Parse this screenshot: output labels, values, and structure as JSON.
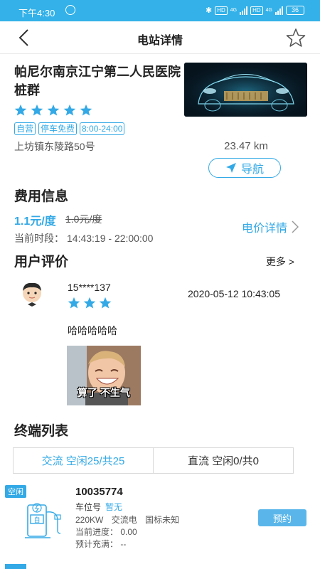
{
  "status_bar": {
    "time": "下午4:30",
    "net1": "HD",
    "net2": "4G",
    "net3": "HD",
    "net4": "4G",
    "battery": "36"
  },
  "nav": {
    "title": "电站详情",
    "back_icon": "back-arrow-icon",
    "fav_icon": "star-outline-icon"
  },
  "station": {
    "name": "帕尼尔南京江宁第二人民医院桩群",
    "rating": 5,
    "tags": [
      "自营",
      "停车免费",
      "8:00-24:00"
    ],
    "address": "上坊镇东陵路50号",
    "distance": "23.47 km",
    "nav_label": "导航"
  },
  "fee": {
    "title": "费用信息",
    "price": "1.1元/度",
    "original_price": "1.0元/度",
    "period_label": "当前时段：",
    "period": "14:43:19 - 22:00:00",
    "detail_label": "电价详情"
  },
  "reviews": {
    "title": "用户评价",
    "more_label": "更多 >",
    "items": [
      {
        "user": "15****137",
        "rating": 3,
        "date": "2020-05-12 10:43:05",
        "text": "哈哈哈哈哈",
        "photo_caption": "算了 不生气"
      }
    ]
  },
  "terminals": {
    "title": "终端列表",
    "tabs": [
      {
        "label": "交流  空闲25/共25",
        "active": true
      },
      {
        "label": "直流  空闲0/共0",
        "active": false
      }
    ],
    "items": [
      {
        "status": "空闲",
        "id": "10035774",
        "spot_label": "车位号",
        "spot_value": "暂无",
        "power": "220KW",
        "current_type": "交流电",
        "standard": "国标未知",
        "progress": "当前进度：  0.00",
        "eta": "预计充满：  --",
        "book_label": "预约"
      }
    ]
  },
  "colors": {
    "accent": "#33a9e6",
    "status_bar": "#33b1e8"
  }
}
